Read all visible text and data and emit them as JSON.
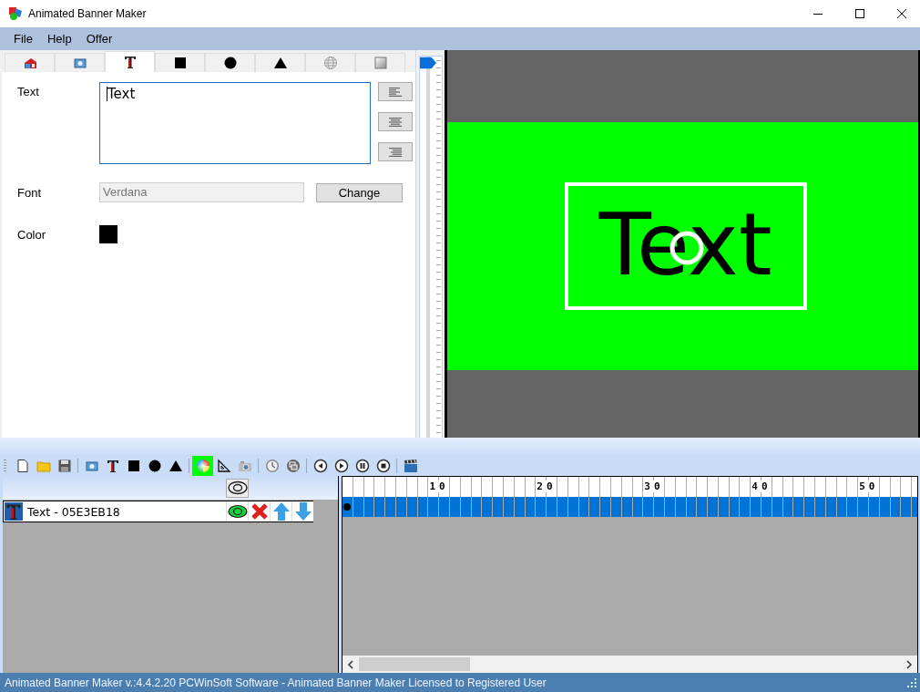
{
  "window": {
    "title": "Animated Banner Maker"
  },
  "menu": [
    "File",
    "Help",
    "Offer"
  ],
  "tabs": [
    {
      "kind": "house",
      "selected": false
    },
    {
      "kind": "image",
      "selected": false
    },
    {
      "kind": "text",
      "selected": true
    },
    {
      "kind": "square",
      "selected": false
    },
    {
      "kind": "circle",
      "selected": false
    },
    {
      "kind": "triangle",
      "selected": false
    },
    {
      "kind": "globe",
      "selected": false
    },
    {
      "kind": "gradient",
      "selected": false
    }
  ],
  "properties": {
    "text_label": "Text",
    "text_value": "Text",
    "align_buttons": [
      {
        "kind": "left"
      },
      {
        "kind": "center"
      },
      {
        "kind": "right"
      }
    ],
    "font_label": "Font",
    "font_value": "Verdana",
    "change_button": "Change",
    "color_label": "Color",
    "color": "#000000"
  },
  "zoom_slider": {
    "level": 1
  },
  "canvas": {
    "preview_text": "Text"
  },
  "toolbar": [
    {
      "kind": "new",
      "selected": false
    },
    {
      "kind": "open",
      "selected": false
    },
    {
      "kind": "save",
      "selected": false
    },
    {
      "kind": "sep"
    },
    {
      "kind": "image",
      "selected": false
    },
    {
      "kind": "text",
      "selected": false
    },
    {
      "kind": "square",
      "selected": false
    },
    {
      "kind": "circle",
      "selected": false
    },
    {
      "kind": "triangle",
      "selected": false
    },
    {
      "kind": "sep"
    },
    {
      "kind": "colors",
      "selected": true
    },
    {
      "kind": "ruler",
      "selected": false
    },
    {
      "kind": "camera",
      "selected": false
    },
    {
      "kind": "sep"
    },
    {
      "kind": "clock",
      "selected": false
    },
    {
      "kind": "layers",
      "selected": false
    },
    {
      "kind": "sep"
    },
    {
      "kind": "prev",
      "selected": false
    },
    {
      "kind": "play",
      "selected": false
    },
    {
      "kind": "pause",
      "selected": false
    },
    {
      "kind": "stop",
      "selected": false
    },
    {
      "kind": "sep"
    },
    {
      "kind": "film",
      "selected": false
    }
  ],
  "layers": [
    {
      "name": "Text - 05E3EB18",
      "visible": true
    }
  ],
  "timeline": {
    "ticks": [
      "10",
      "20",
      "30",
      "40",
      "50"
    ]
  },
  "status_bar": "Animated Banner Maker v.:4.4.2.20 PCWinSoft Software - Animated Banner Maker Licensed to Registered User"
}
